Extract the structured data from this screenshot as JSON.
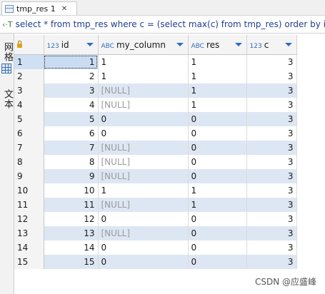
{
  "tab": {
    "label": "tmp_res 1",
    "close": "✕"
  },
  "sql": {
    "icon": "‹·T",
    "text": "select * from tmp_res where c = (select max(c) from tmp_res) order by id"
  },
  "side": {
    "grid_label": "网格",
    "text_label": "文本"
  },
  "columns": [
    {
      "type": "123",
      "name": "id"
    },
    {
      "type": "ABC",
      "name": "my_column"
    },
    {
      "type": "ABC",
      "name": "res"
    },
    {
      "type": "123",
      "name": "c"
    }
  ],
  "rows": [
    {
      "num": "1",
      "id": "1",
      "my_column": "1",
      "res": "1",
      "c": "3"
    },
    {
      "num": "2",
      "id": "2",
      "my_column": "1",
      "res": "1",
      "c": "3"
    },
    {
      "num": "3",
      "id": "3",
      "my_column": "[NULL]",
      "res": "1",
      "c": "3"
    },
    {
      "num": "4",
      "id": "4",
      "my_column": "[NULL]",
      "res": "1",
      "c": "3"
    },
    {
      "num": "5",
      "id": "5",
      "my_column": "0",
      "res": "0",
      "c": "3"
    },
    {
      "num": "6",
      "id": "6",
      "my_column": "0",
      "res": "0",
      "c": "3"
    },
    {
      "num": "7",
      "id": "7",
      "my_column": "[NULL]",
      "res": "0",
      "c": "3"
    },
    {
      "num": "8",
      "id": "8",
      "my_column": "[NULL]",
      "res": "0",
      "c": "3"
    },
    {
      "num": "9",
      "id": "9",
      "my_column": "[NULL]",
      "res": "0",
      "c": "3"
    },
    {
      "num": "10",
      "id": "10",
      "my_column": "1",
      "res": "1",
      "c": "3"
    },
    {
      "num": "11",
      "id": "11",
      "my_column": "[NULL]",
      "res": "1",
      "c": "3"
    },
    {
      "num": "12",
      "id": "12",
      "my_column": "0",
      "res": "0",
      "c": "3"
    },
    {
      "num": "13",
      "id": "13",
      "my_column": "[NULL]",
      "res": "0",
      "c": "3"
    },
    {
      "num": "14",
      "id": "14",
      "my_column": "0",
      "res": "0",
      "c": "3"
    },
    {
      "num": "15",
      "id": "15",
      "my_column": "0",
      "res": "0",
      "c": "3"
    }
  ],
  "watermark": "CSDN @应盛峰"
}
